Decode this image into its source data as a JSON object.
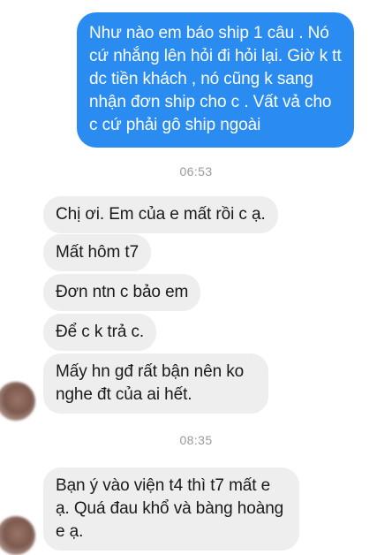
{
  "conversation": {
    "outgoing": [
      {
        "text": "Như nào em báo ship 1 câu . Nó cứ nhắng lên hỏi đi hỏi lại. Giờ k tt dc tiền khách , nó cũng k sang nhận đơn ship cho c . Vất vả cho c cứ phải gô ship ngoài"
      }
    ],
    "timestamps": [
      "06:53",
      "08:35"
    ],
    "incoming_group_1": [
      {
        "text": "Chị ơi. Em của e mất rồi c ạ."
      },
      {
        "text": "Mất hôm t7"
      },
      {
        "text": "Đơn ntn c bảo em"
      },
      {
        "text": "Để c k trả c."
      },
      {
        "text": "Mấy hn gđ rất bận nên ko nghe đt của ai hết."
      }
    ],
    "incoming_group_2": [
      {
        "text": "Bạn ý vào viện t4 thì t7 mất e ạ. Quá đau khổ và bàng hoàng e ạ."
      }
    ],
    "colors": {
      "outgoing_bubble": "#2a8cf0",
      "incoming_bubble": "#eeeeef",
      "timestamp_text": "#9a9a9f"
    }
  }
}
